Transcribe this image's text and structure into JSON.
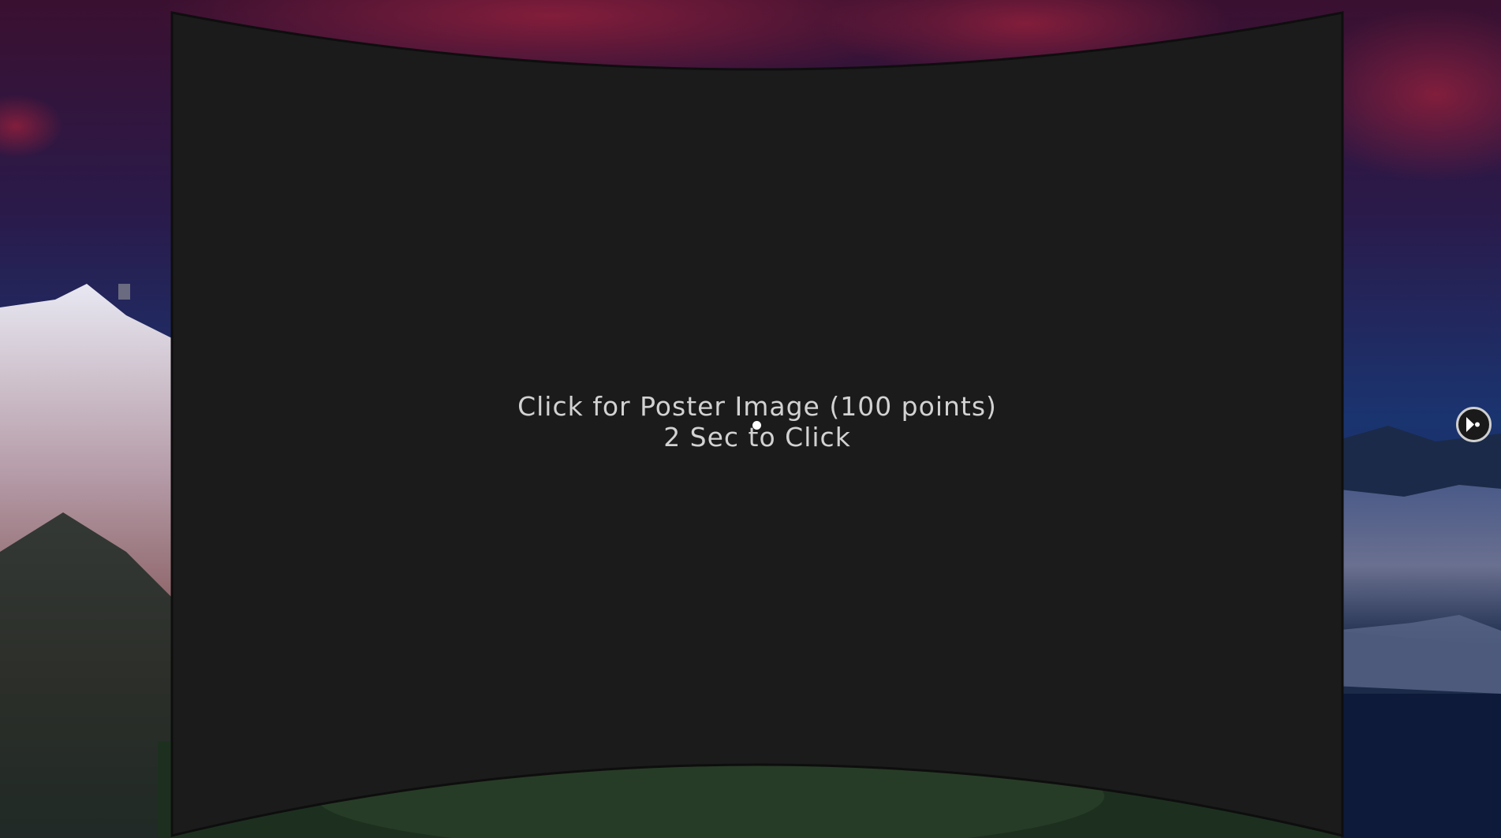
{
  "poster_panel": {
    "line1": "Click for Poster Image (100 points)",
    "line2": "2 Sec to Click"
  },
  "colors": {
    "panel": "#1b1b1b",
    "text": "#d2d2d2",
    "sky_top": "#3a1030",
    "sky_bottom": "#15306a"
  },
  "icons": {
    "gaze_cursor": "reticle-icon",
    "center_pointer": "gaze-dot-icon"
  }
}
